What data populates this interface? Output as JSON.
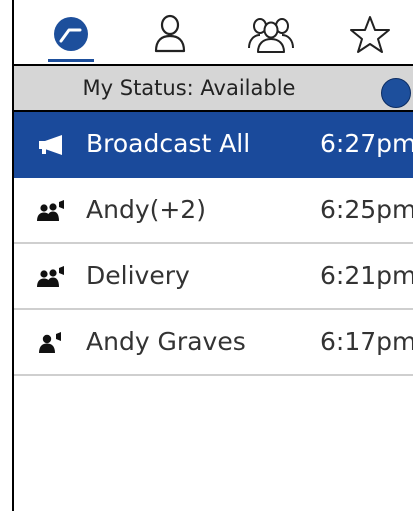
{
  "tabs": [
    {
      "name": "recents-tab",
      "icon": "clock-icon"
    },
    {
      "name": "contacts-tab",
      "icon": "person-icon"
    },
    {
      "name": "groups-tab",
      "icon": "group-icon"
    },
    {
      "name": "favorites-tab",
      "icon": "star-icon"
    }
  ],
  "status": {
    "label": "My Status: Available",
    "indicator_color": "#1d4f9c"
  },
  "conversations": [
    {
      "name": "Broadcast All",
      "time": "6:27pm",
      "icon": "megaphone-icon",
      "selected": true
    },
    {
      "name": "Andy(+2)",
      "time": "6:25pm",
      "icon": "group-talk-icon",
      "selected": false
    },
    {
      "name": "Delivery",
      "time": "6:21pm",
      "icon": "group-talk-icon",
      "selected": false
    },
    {
      "name": "Andy Graves",
      "time": "6:17pm",
      "icon": "person-talk-icon",
      "selected": false
    }
  ],
  "colors": {
    "accent": "#1a4a9b",
    "status_bar": "#d6d6d6"
  }
}
